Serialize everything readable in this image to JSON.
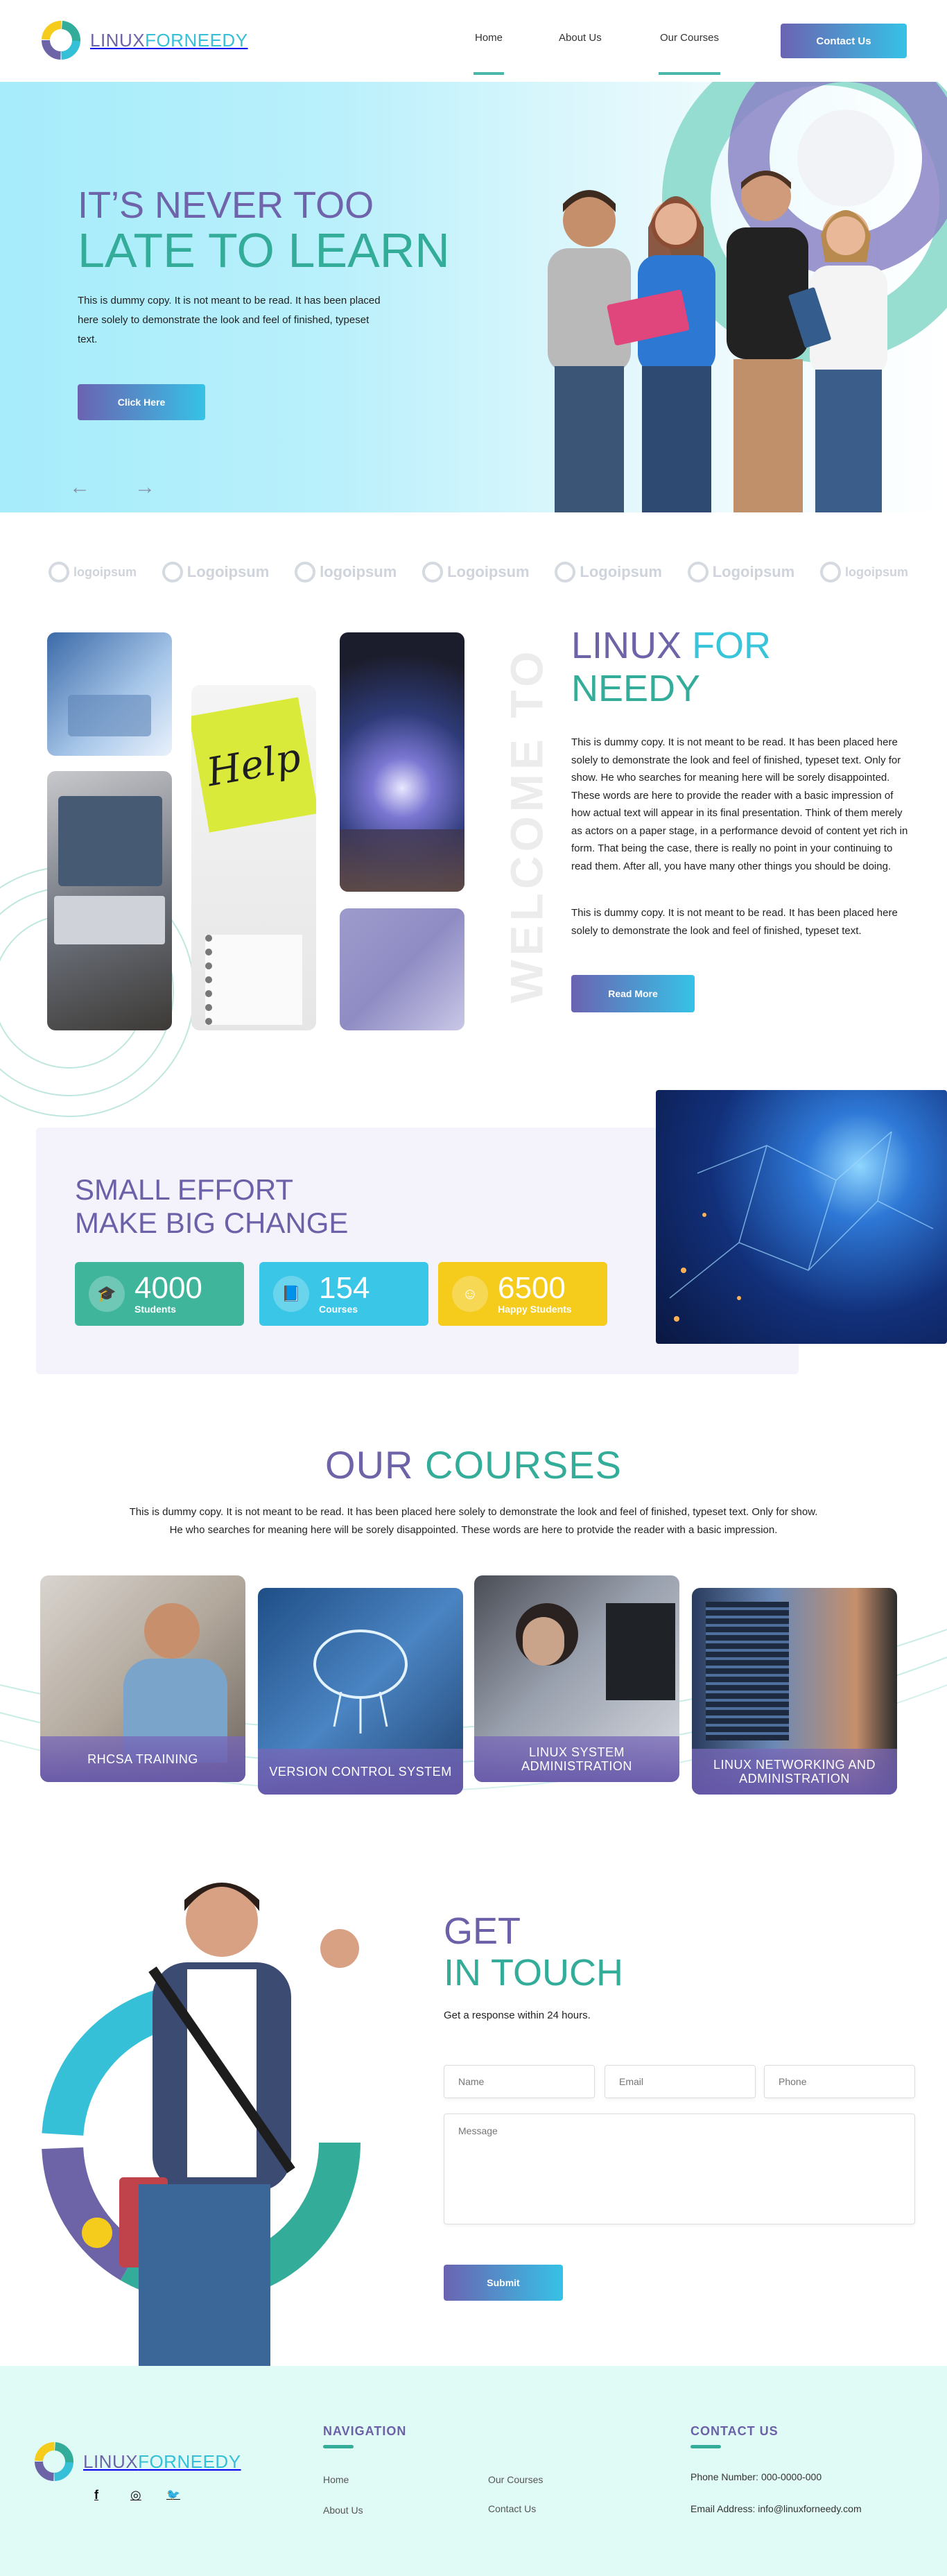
{
  "brand": {
    "name_part1": "LINUX",
    "name_part2": "FORNEEDY"
  },
  "nav": {
    "items": [
      {
        "label": "Home"
      },
      {
        "label": "About Us"
      },
      {
        "label": "Our Courses"
      }
    ],
    "contact_button": "Contact Us"
  },
  "hero": {
    "title_line1": "IT’S NEVER TOO",
    "title_line2": "LATE TO LEARN",
    "body": "This is dummy copy. It is not meant to be read. It has been placed here solely to demonstrate the look and feel of finished, typeset text.",
    "button": "Click Here",
    "prev_arrow": "←",
    "next_arrow": "→"
  },
  "partner_logos": [
    "logoipsum",
    "Logoipsum",
    "logoipsum",
    "Logoipsum",
    "Logoipsum",
    "Logoipsum",
    "logoipsum"
  ],
  "about": {
    "vertical_text": "WELCOME TO",
    "title_part1": "LINUX",
    "title_part2": "FOR",
    "title_part3": "NEEDY",
    "paragraph1": "This is dummy copy. It is not meant to be read. It has been placed here solely to demonstrate the look and feel of finished, typeset text. Only for show. He who searches for meaning here will be sorely disappointed. These words are here to provide the reader with a basic impression of how actual text will appear in its final presentation. Think of them merely as actors on a paper stage, in a performance devoid of content yet rich in form. That being the case, there is really no point in your continuing to read them. After all, you have many other things you should be doing.",
    "paragraph2": "This is dummy copy. It is not meant to be read. It has been placed here solely to demonstrate the look and feel of finished, typeset text.",
    "button": "Read More",
    "help_note": "Help"
  },
  "effort": {
    "title_line1": "SMALL EFFORT",
    "title_line2": "MAKE BIG CHANGE",
    "stats": [
      {
        "value": "4000",
        "label": "Students",
        "color": "#3fb69c"
      },
      {
        "value": "154",
        "label": "Courses",
        "color": "#3ac6e7"
      },
      {
        "value": "6500",
        "label": "Happy Students",
        "color": "#f5cb1c"
      }
    ]
  },
  "courses": {
    "title_part1": "OUR",
    "title_part2": "COURSES",
    "description": "This is dummy copy. It is not meant to be read. It has been placed here solely to demonstrate the look and feel of finished, typeset text. Only for show. He who searches for meaning here will be sorely disappointed. These words are here to protvide the reader with a basic impression.",
    "items": [
      {
        "label": "RHCSA TRAINING"
      },
      {
        "label": "VERSION CONTROL SYSTEM"
      },
      {
        "label": "LINUX SYSTEM ADMINISTRATION"
      },
      {
        "label": "LINUX NETWORKING AND ADMINISTRATION"
      }
    ]
  },
  "contact": {
    "title_line1": "GET",
    "title_line2": "IN TOUCH",
    "subtitle": "Get a response within 24 hours.",
    "name_placeholder": "Name",
    "email_placeholder": "Email",
    "phone_placeholder": "Phone",
    "message_placeholder": "Message",
    "submit": "Submit"
  },
  "footer": {
    "navigation_heading": "NAVIGATION",
    "links": [
      "Home",
      "Our Courses",
      "About Us",
      "Contact Us"
    ],
    "contact_heading": "CONTACT US",
    "phone": "Phone Number: 000-0000-000",
    "email": "Email Address: info@linuxforneedy.com",
    "social": {
      "facebook": "f",
      "instagram": "◎",
      "twitter": "🐦"
    }
  },
  "colors": {
    "brand_purple": "#6d64a8",
    "brand_teal": "#33ad99",
    "brand_cyan": "#38c4d9",
    "accent_yellow": "#f5cb1c"
  }
}
